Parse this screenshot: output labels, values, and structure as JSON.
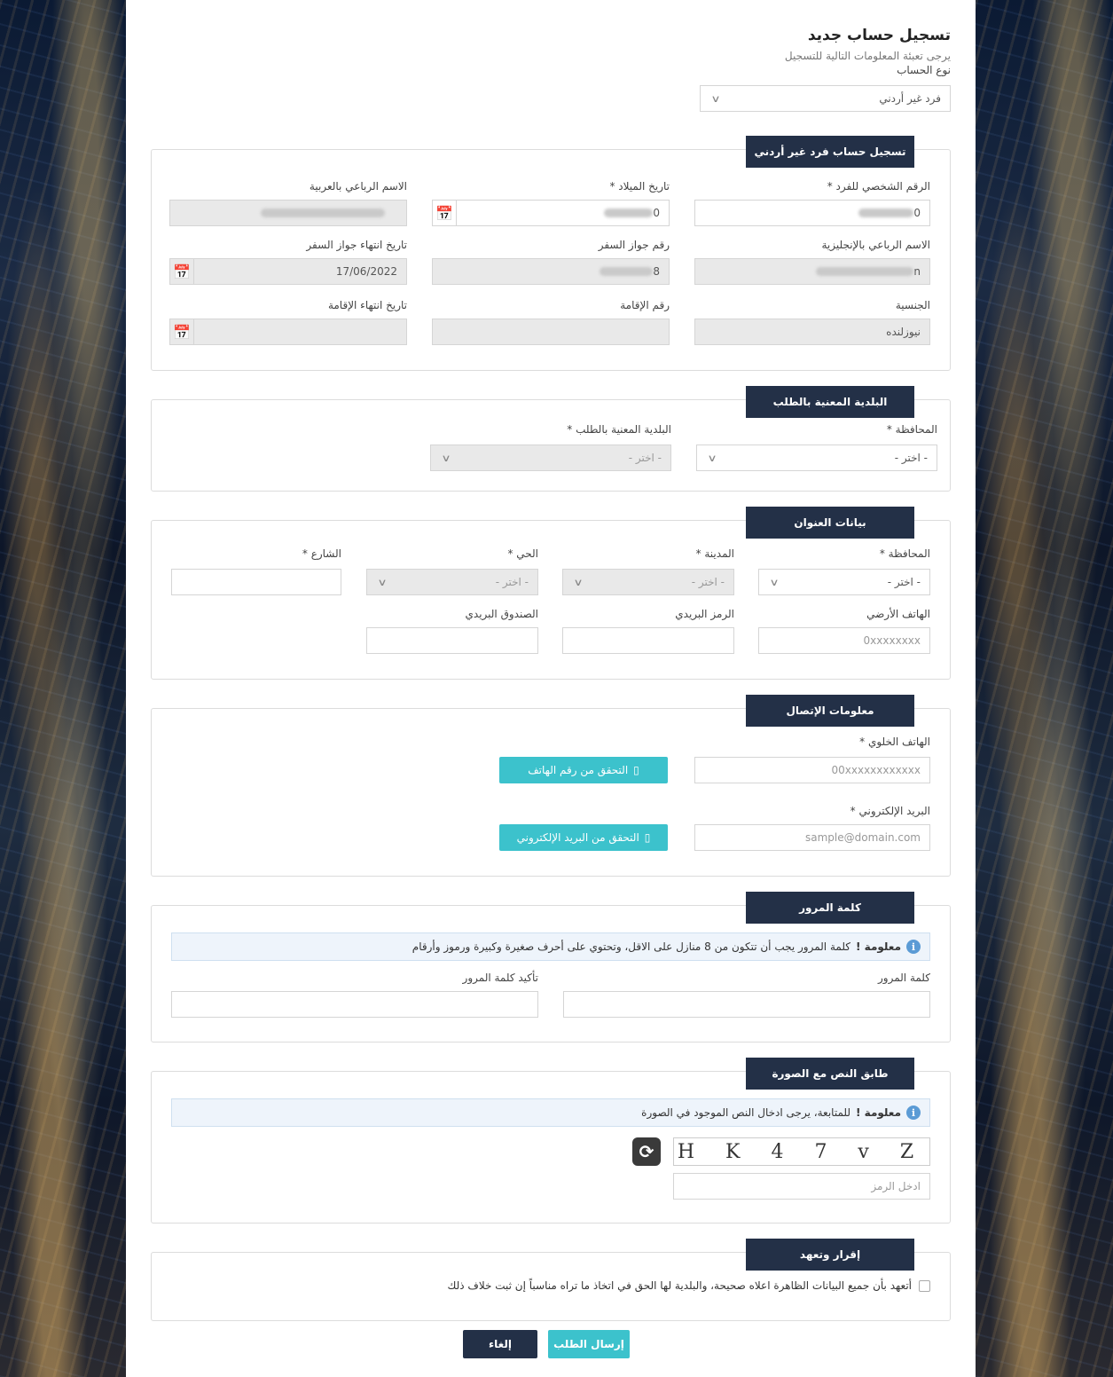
{
  "header": {
    "title": "تسجيل حساب جديد",
    "subtitle": "يرجى تعبئة المعلومات التالية للتسجيل",
    "account_type_label": "نوع الحساب",
    "account_type_value": "فرد غير أردني"
  },
  "personal": {
    "tab": "تسجيل حساب فرد غير أردني",
    "id_label": "الرقم الشخصي للفرد *",
    "id_value_tail": "0",
    "dob_label": "تاريخ الميلاد *",
    "dob_value_tail": "0",
    "arabic_name_label": "الاسم الرباعي بالعربية",
    "english_name_label": "الاسم الرباعي بالإنجليزية",
    "english_name_tail": "n",
    "passport_label": "رقم جواز السفر",
    "passport_tail": "8",
    "passport_expiry_label": "تاريخ انتهاء جواز السفر",
    "passport_expiry_value": "17/06/2022",
    "nationality_label": "الجنسية",
    "nationality_value": "نيوزلنده",
    "residence_label": "رقم الإقامة",
    "residence_expiry_label": "تاريخ انتهاء الإقامة"
  },
  "municipality": {
    "tab": "البلدية المعنية بالطلب",
    "governorate_label": "المحافظة *",
    "governorate_value": "- اختر -",
    "municipality_label": "البلدية المعنية بالطلب *",
    "municipality_value": "- اختر -"
  },
  "address": {
    "tab": "بيانات العنوان",
    "governorate_label": "المحافظة *",
    "governorate_value": "- اختر -",
    "city_label": "المدينة *",
    "city_value": "- اختر -",
    "district_label": "الحي *",
    "district_value": "- اختر -",
    "street_label": "الشارع *",
    "landline_label": "الهاتف الأرضي",
    "landline_placeholder": "0xxxxxxxx",
    "postal_code_label": "الرمز البريدي",
    "po_box_label": "الصندوق البريدي"
  },
  "contact": {
    "tab": "معلومات الإتصال",
    "mobile_label": "الهاتف الخلوي *",
    "mobile_placeholder": "00xxxxxxxxxxxx",
    "verify_phone_button": "التحقق من رقم الهاتف",
    "email_label": "البريد الإلكتروني *",
    "email_placeholder": "sample@domain.com",
    "verify_email_button": "التحقق من البريد الإلكتروني"
  },
  "password": {
    "tab": "كلمة المرور",
    "info_title": "معلومة !",
    "info_text": "كلمة المرور يجب أن تتكون من 8 منازل على الاقل، وتحتوي على أحرف صغيرة وكبيرة ورموز وأرقام",
    "password_label": "كلمة المرور",
    "confirm_label": "تأكيد كلمة المرور"
  },
  "captcha": {
    "tab": "طابق النص مع الصورة",
    "info_title": "معلومة !",
    "info_text": "للمتابعة، يرجى ادخال النص الموجود في الصورة",
    "captcha_text": "H K 4 7 v Z",
    "input_placeholder": "ادخل الرمز"
  },
  "declaration": {
    "tab": "إقرار وتعهد",
    "text": "أتعهد بأن جميع البيانات الظاهرة اعلاه صحيحة، والبلدية لها الحق في اتخاذ ما تراه مناسباً إن ثبت خلاف ذلك"
  },
  "actions": {
    "submit": "إرسال الطلب",
    "cancel": "إلغاء"
  },
  "colors": {
    "header_tab": "#233047",
    "teal_button": "#3cc2cc",
    "info_bg": "#eef4fb"
  },
  "icons": [
    "calendar-icon",
    "chevron-down-icon",
    "phone-icon",
    "email-icon",
    "info-icon",
    "refresh-icon",
    "checkbox"
  ]
}
